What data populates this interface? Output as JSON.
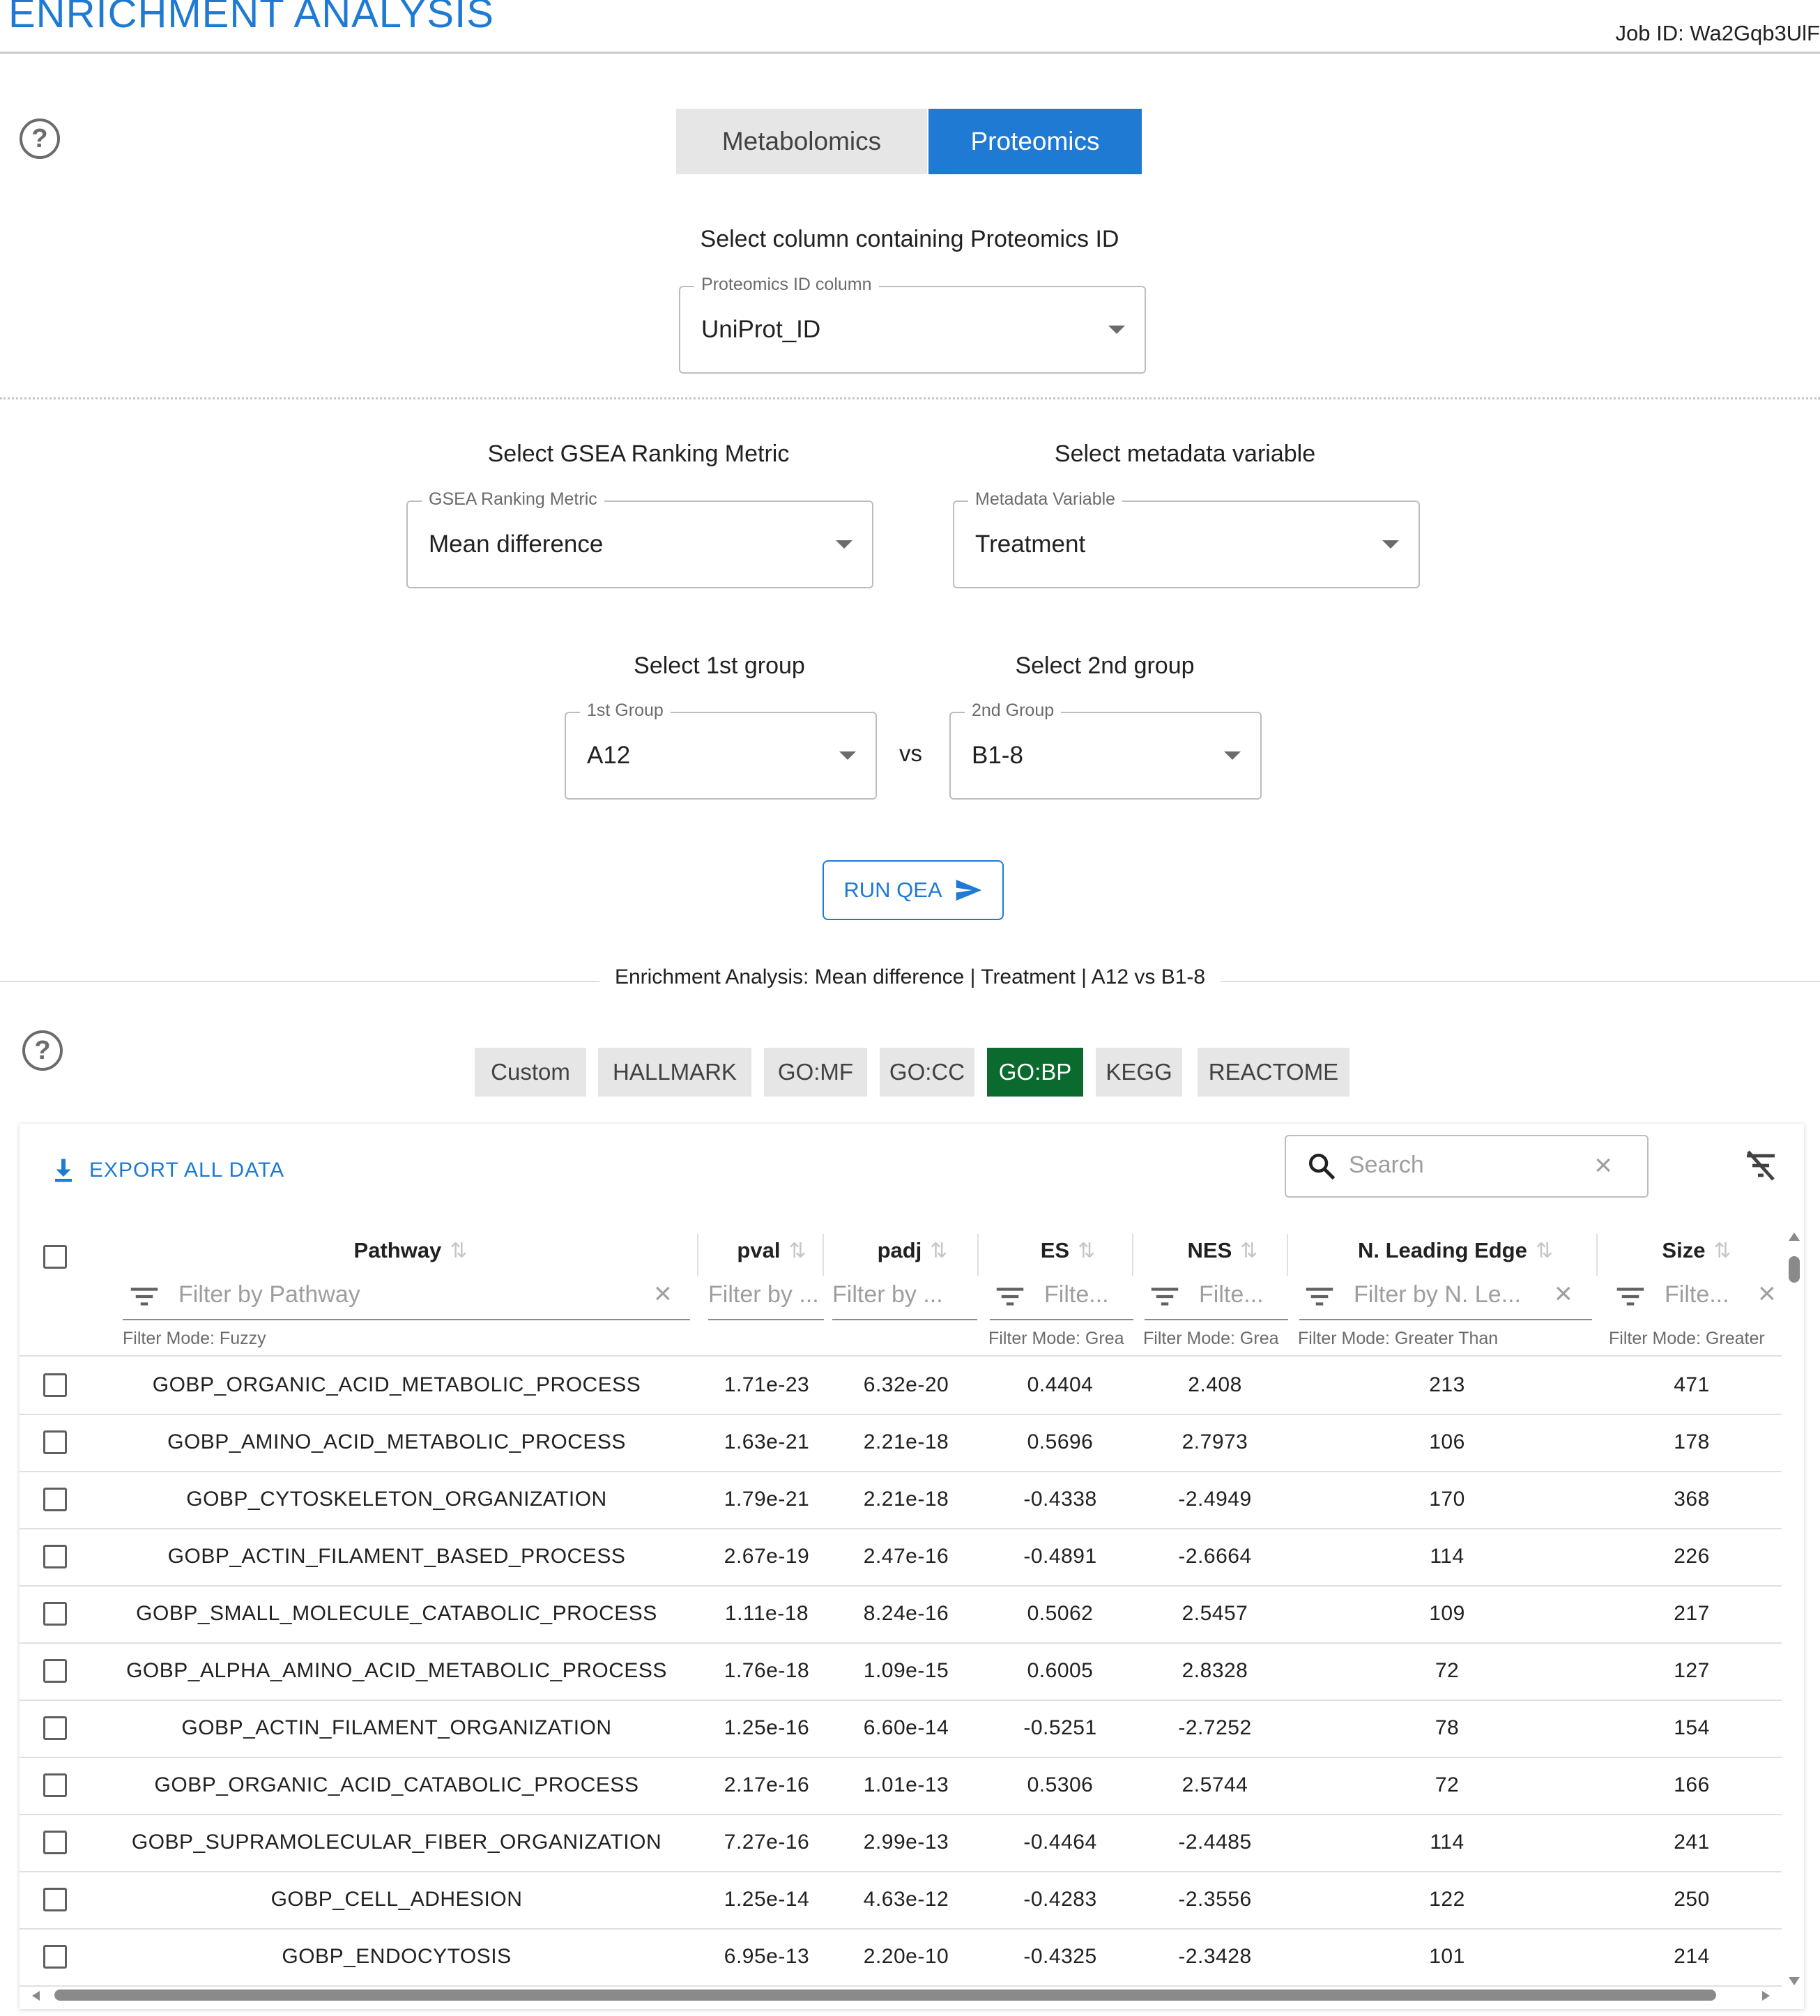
{
  "header": {
    "title": "ENRICHMENT ANALYSIS",
    "job_id": "Job ID: Wa2Gqb3UlF"
  },
  "mode_tabs": [
    {
      "label": "Metabolomics",
      "active": false
    },
    {
      "label": "Proteomics",
      "active": true
    }
  ],
  "id_column": {
    "heading": "Select column containing Proteomics ID",
    "legend": "Proteomics ID column",
    "value": "UniProt_ID"
  },
  "ranking_metric": {
    "heading": "Select GSEA Ranking Metric",
    "legend": "GSEA Ranking Metric",
    "value": "Mean difference"
  },
  "metadata_variable": {
    "heading": "Select metadata variable",
    "legend": "Metadata Variable",
    "value": "Treatment"
  },
  "group1": {
    "heading": "Select 1st group",
    "legend": "1st Group",
    "value": "A12"
  },
  "group2": {
    "heading": "Select 2nd group",
    "legend": "2nd Group",
    "value": "B1-8"
  },
  "vs_label": "vs",
  "run_button": "RUN QEA",
  "results_divider": "Enrichment Analysis: Mean difference | Treatment | A12 vs B1-8",
  "db_tabs": [
    {
      "label": "Custom",
      "active": false
    },
    {
      "label": "HALLMARK",
      "active": false
    },
    {
      "label": "GO:MF",
      "active": false
    },
    {
      "label": "GO:CC",
      "active": false
    },
    {
      "label": "GO:BP",
      "active": true
    },
    {
      "label": "KEGG",
      "active": false
    },
    {
      "label": "REACTOME",
      "active": false
    }
  ],
  "toolbar": {
    "export_label": "EXPORT ALL DATA",
    "search_placeholder": "Search"
  },
  "columns": [
    {
      "label": "Pathway",
      "filter_placeholder": "Filter by Pathway",
      "filter_mode": "Filter Mode: Fuzzy"
    },
    {
      "label": "pval",
      "filter_placeholder": "Filter by ...",
      "filter_mode": ""
    },
    {
      "label": "padj",
      "filter_placeholder": "Filter by ...",
      "filter_mode": ""
    },
    {
      "label": "ES",
      "filter_placeholder": "Filte...",
      "filter_mode": "Filter Mode: Grea"
    },
    {
      "label": "NES",
      "filter_placeholder": "Filte...",
      "filter_mode": "Filter Mode: Grea"
    },
    {
      "label": "N. Leading Edge",
      "filter_placeholder": "Filter by N. Le...",
      "filter_mode": "Filter Mode: Greater Than"
    },
    {
      "label": "Size",
      "filter_placeholder": "Filte...",
      "filter_mode": "Filter Mode: Greater"
    }
  ],
  "rows": [
    {
      "pathway": "GOBP_ORGANIC_ACID_METABOLIC_PROCESS",
      "pval": "1.71e-23",
      "padj": "6.32e-20",
      "es": "0.4404",
      "nes": "2.408",
      "nle": "213",
      "size": "471"
    },
    {
      "pathway": "GOBP_AMINO_ACID_METABOLIC_PROCESS",
      "pval": "1.63e-21",
      "padj": "2.21e-18",
      "es": "0.5696",
      "nes": "2.7973",
      "nle": "106",
      "size": "178"
    },
    {
      "pathway": "GOBP_CYTOSKELETON_ORGANIZATION",
      "pval": "1.79e-21",
      "padj": "2.21e-18",
      "es": "-0.4338",
      "nes": "-2.4949",
      "nle": "170",
      "size": "368"
    },
    {
      "pathway": "GOBP_ACTIN_FILAMENT_BASED_PROCESS",
      "pval": "2.67e-19",
      "padj": "2.47e-16",
      "es": "-0.4891",
      "nes": "-2.6664",
      "nle": "114",
      "size": "226"
    },
    {
      "pathway": "GOBP_SMALL_MOLECULE_CATABOLIC_PROCESS",
      "pval": "1.11e-18",
      "padj": "8.24e-16",
      "es": "0.5062",
      "nes": "2.5457",
      "nle": "109",
      "size": "217"
    },
    {
      "pathway": "GOBP_ALPHA_AMINO_ACID_METABOLIC_PROCESS",
      "pval": "1.76e-18",
      "padj": "1.09e-15",
      "es": "0.6005",
      "nes": "2.8328",
      "nle": "72",
      "size": "127"
    },
    {
      "pathway": "GOBP_ACTIN_FILAMENT_ORGANIZATION",
      "pval": "1.25e-16",
      "padj": "6.60e-14",
      "es": "-0.5251",
      "nes": "-2.7252",
      "nle": "78",
      "size": "154"
    },
    {
      "pathway": "GOBP_ORGANIC_ACID_CATABOLIC_PROCESS",
      "pval": "2.17e-16",
      "padj": "1.01e-13",
      "es": "0.5306",
      "nes": "2.5744",
      "nle": "72",
      "size": "166"
    },
    {
      "pathway": "GOBP_SUPRAMOLECULAR_FIBER_ORGANIZATION",
      "pval": "7.27e-16",
      "padj": "2.99e-13",
      "es": "-0.4464",
      "nes": "-2.4485",
      "nle": "114",
      "size": "241"
    },
    {
      "pathway": "GOBP_CELL_ADHESION",
      "pval": "1.25e-14",
      "padj": "4.63e-12",
      "es": "-0.4283",
      "nes": "-2.3556",
      "nle": "122",
      "size": "250"
    },
    {
      "pathway": "GOBP_ENDOCYTOSIS",
      "pval": "6.95e-13",
      "padj": "2.20e-10",
      "es": "-0.4325",
      "nes": "-2.3428",
      "nle": "101",
      "size": "214"
    }
  ],
  "colors": {
    "accent_blue": "#1e7ad2",
    "active_db_tab": "#0b6a2d"
  }
}
